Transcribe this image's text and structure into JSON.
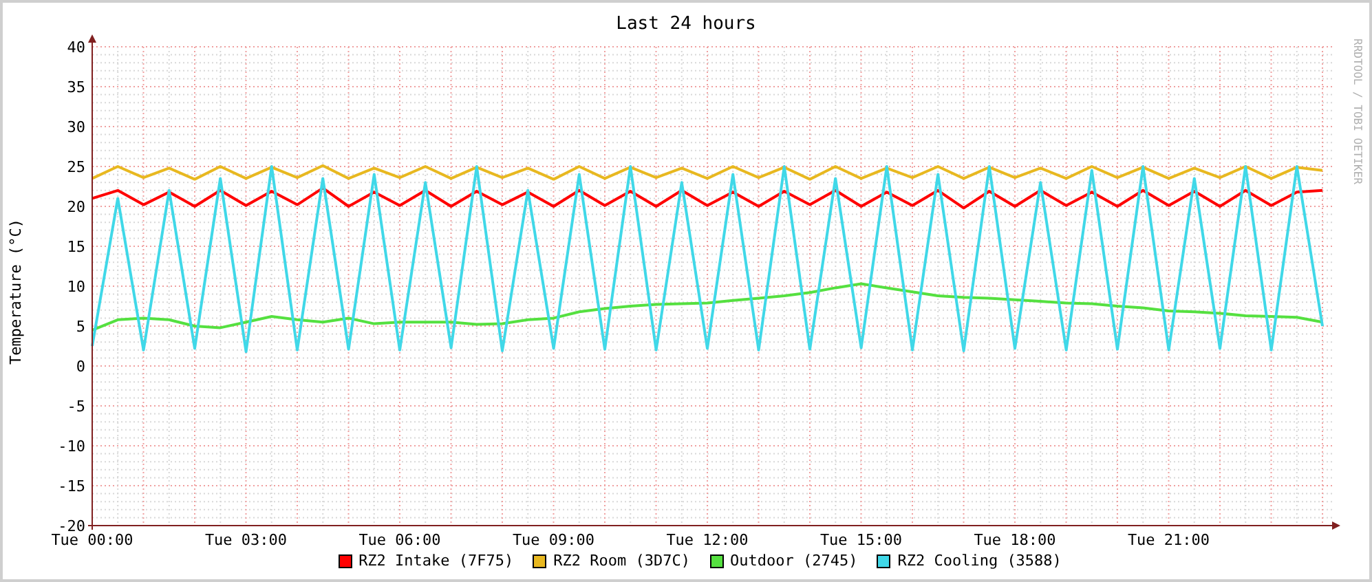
{
  "graph": {
    "credit": "RRDTOOL / TOBI OETIKER",
    "chart_data": {
      "type": "line",
      "title": "Last 24 hours",
      "ylabel": "Temperature (°C)",
      "categories": [
        "Tue 00:00",
        null,
        null,
        null,
        null,
        null,
        "Tue 03:00",
        null,
        null,
        null,
        null,
        null,
        "Tue 06:00",
        null,
        null,
        null,
        null,
        null,
        "Tue 09:00",
        null,
        null,
        null,
        null,
        null,
        "Tue 12:00",
        null,
        null,
        null,
        null,
        null,
        "Tue 15:00",
        null,
        null,
        null,
        null,
        null,
        "Tue 18:00",
        null,
        null,
        null,
        null,
        null,
        "Tue 21:00",
        null,
        null,
        null,
        null,
        null,
        null
      ],
      "ylim": [
        -20,
        40
      ],
      "grid": true,
      "yticks": [
        -20,
        -15,
        -10,
        -5,
        0,
        5,
        10,
        15,
        20,
        25,
        30,
        35,
        40
      ],
      "series": [
        {
          "name": "RZ2 Intake (7F75)",
          "color": "#ff0000",
          "values": [
            21,
            22,
            20.2,
            21.8,
            20,
            22,
            20.1,
            21.9,
            20.2,
            22.3,
            20,
            21.8,
            20.1,
            22,
            20,
            21.9,
            20.2,
            21.8,
            20,
            22,
            20.1,
            21.9,
            20,
            22,
            20.1,
            21.8,
            20,
            21.9,
            20.2,
            22,
            20,
            21.8,
            20.1,
            22,
            19.8,
            21.9,
            20,
            22,
            20.1,
            21.8,
            20,
            22,
            20.1,
            21.9,
            20,
            22,
            20.1,
            21.8,
            22
          ]
        },
        {
          "name": "RZ2 Room (3D7C)",
          "color": "#e8b820",
          "values": [
            23.5,
            25,
            23.6,
            24.8,
            23.4,
            25,
            23.5,
            24.9,
            23.6,
            25.1,
            23.5,
            24.8,
            23.6,
            25,
            23.5,
            24.9,
            23.6,
            24.8,
            23.4,
            25,
            23.5,
            24.9,
            23.6,
            24.8,
            23.5,
            25,
            23.6,
            24.9,
            23.4,
            25,
            23.5,
            24.8,
            23.6,
            25,
            23.5,
            24.9,
            23.6,
            24.8,
            23.5,
            25,
            23.6,
            24.9,
            23.5,
            24.8,
            23.6,
            25,
            23.5,
            24.9,
            24.5
          ]
        },
        {
          "name": "Outdoor (2745)",
          "color": "#55e040",
          "values": [
            4.5,
            5.8,
            6,
            5.8,
            5,
            4.8,
            5.5,
            6.2,
            5.8,
            5.5,
            6,
            5.3,
            5.5,
            5.5,
            5.5,
            5.2,
            5.3,
            5.8,
            6,
            6.8,
            7.2,
            7.5,
            7.7,
            7.8,
            7.9,
            8.2,
            8.5,
            8.8,
            9.2,
            9.8,
            10.3,
            9.8,
            9.3,
            8.8,
            8.6,
            8.5,
            8.3,
            8.1,
            7.9,
            7.8,
            7.5,
            7.3,
            6.9,
            6.8,
            6.6,
            6.3,
            6.2,
            6.1,
            5.5
          ]
        },
        {
          "name": "RZ2 Cooling (3588)",
          "color": "#40d8e8",
          "values": [
            2.5,
            21,
            2,
            22,
            2.2,
            23.5,
            1.8,
            25,
            2,
            23.5,
            2.1,
            24,
            2,
            23,
            2.3,
            25,
            1.9,
            22,
            2.2,
            24,
            2.1,
            25,
            2,
            23,
            2.2,
            24,
            2,
            25,
            2.1,
            23.5,
            2.3,
            25,
            2,
            24,
            1.9,
            25,
            2.2,
            23,
            2,
            24.5,
            2.1,
            25,
            2,
            23.5,
            2.2,
            25,
            2,
            25,
            5
          ]
        }
      ]
    }
  }
}
